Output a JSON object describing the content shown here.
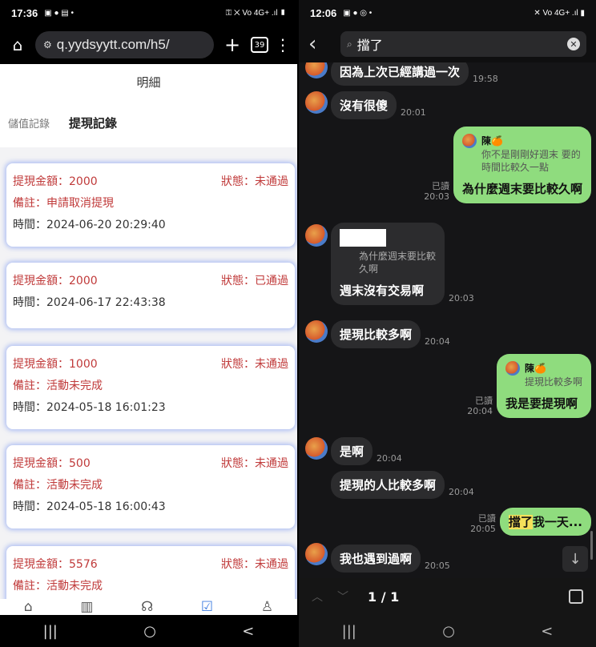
{
  "left": {
    "status_bar": {
      "time": "17:36",
      "icons_left": "▣ ● ▤ •",
      "icons_right": "⚿ ✕ Vo 4G+ .ıl ▮"
    },
    "browser": {
      "home_icon": "home-icon",
      "url": "q.yydsyytt.com/h5/",
      "tabs_count": "39"
    },
    "page": {
      "title": "明細",
      "tabs": [
        {
          "label": "儲值記錄"
        },
        {
          "label": "提現記錄"
        }
      ],
      "records": [
        {
          "amount": "提現金額：2000",
          "status": "狀態：未通過",
          "note": "備註：申請取消提現",
          "time": "時間：2024-06-20 20:29:40"
        },
        {
          "amount": "提現金額：2000",
          "status": "狀態：已通過",
          "note": "",
          "time": "時間：2024-06-17 22:43:38"
        },
        {
          "amount": "提現金額：1000",
          "status": "狀態：未通過",
          "note": "備註：活動未完成",
          "time": "時間：2024-05-18 16:01:23"
        },
        {
          "amount": "提現金額：500",
          "status": "狀態：未通過",
          "note": "備註：活動未完成",
          "time": "時間：2024-05-18 16:00:43"
        },
        {
          "amount": "提現金額：5576",
          "status": "狀態：未通過",
          "note": "備註：活動未完成",
          "time": ""
        }
      ]
    },
    "bottom_nav": [
      "home-icon",
      "chart-icon",
      "support-icon",
      "check-icon",
      "user-icon"
    ]
  },
  "right": {
    "status_bar": {
      "time": "12:06",
      "icons_left": "▣ ● ◎ •",
      "icons_right": "✕ Vo 4G+ .ıl ▮"
    },
    "search": {
      "query": "擋了",
      "back_icon": "back-arrow-icon",
      "clear_icon": "clear-icon"
    },
    "messages": [
      {
        "text": "因為上次已經講過一次",
        "time": "19:58"
      },
      {
        "text": "沒有很傻",
        "time": "20:01"
      },
      {
        "reply_name": "陳🍊",
        "reply_text": "你不是剛剛好週末 要的\n時間比較久一點",
        "text": "為什麼週末要比較久啊",
        "read": "已讀",
        "time": "20:03"
      },
      {
        "reply_text": "為什麼週末要比較\n久啊",
        "text": "週末沒有交易啊",
        "time": "20:03"
      },
      {
        "text": "提現比較多啊",
        "time": "20:04"
      },
      {
        "reply_name": "陳🍊",
        "reply_text": "提現比較多啊",
        "text": "我是要提現啊",
        "read": "已讀",
        "time": "20:04"
      },
      {
        "text": "是啊",
        "time": "20:04"
      },
      {
        "text": "提現的人比較多啊",
        "time": "20:04"
      },
      {
        "highlight": "擋了",
        "text": "我一天...",
        "read": "已讀",
        "time": "20:05"
      },
      {
        "text": "我也遇到過啊",
        "time": "20:05"
      }
    ],
    "find_bar": {
      "count": "1 / 1"
    }
  },
  "android_nav": [
    "|||",
    "○",
    "<"
  ]
}
